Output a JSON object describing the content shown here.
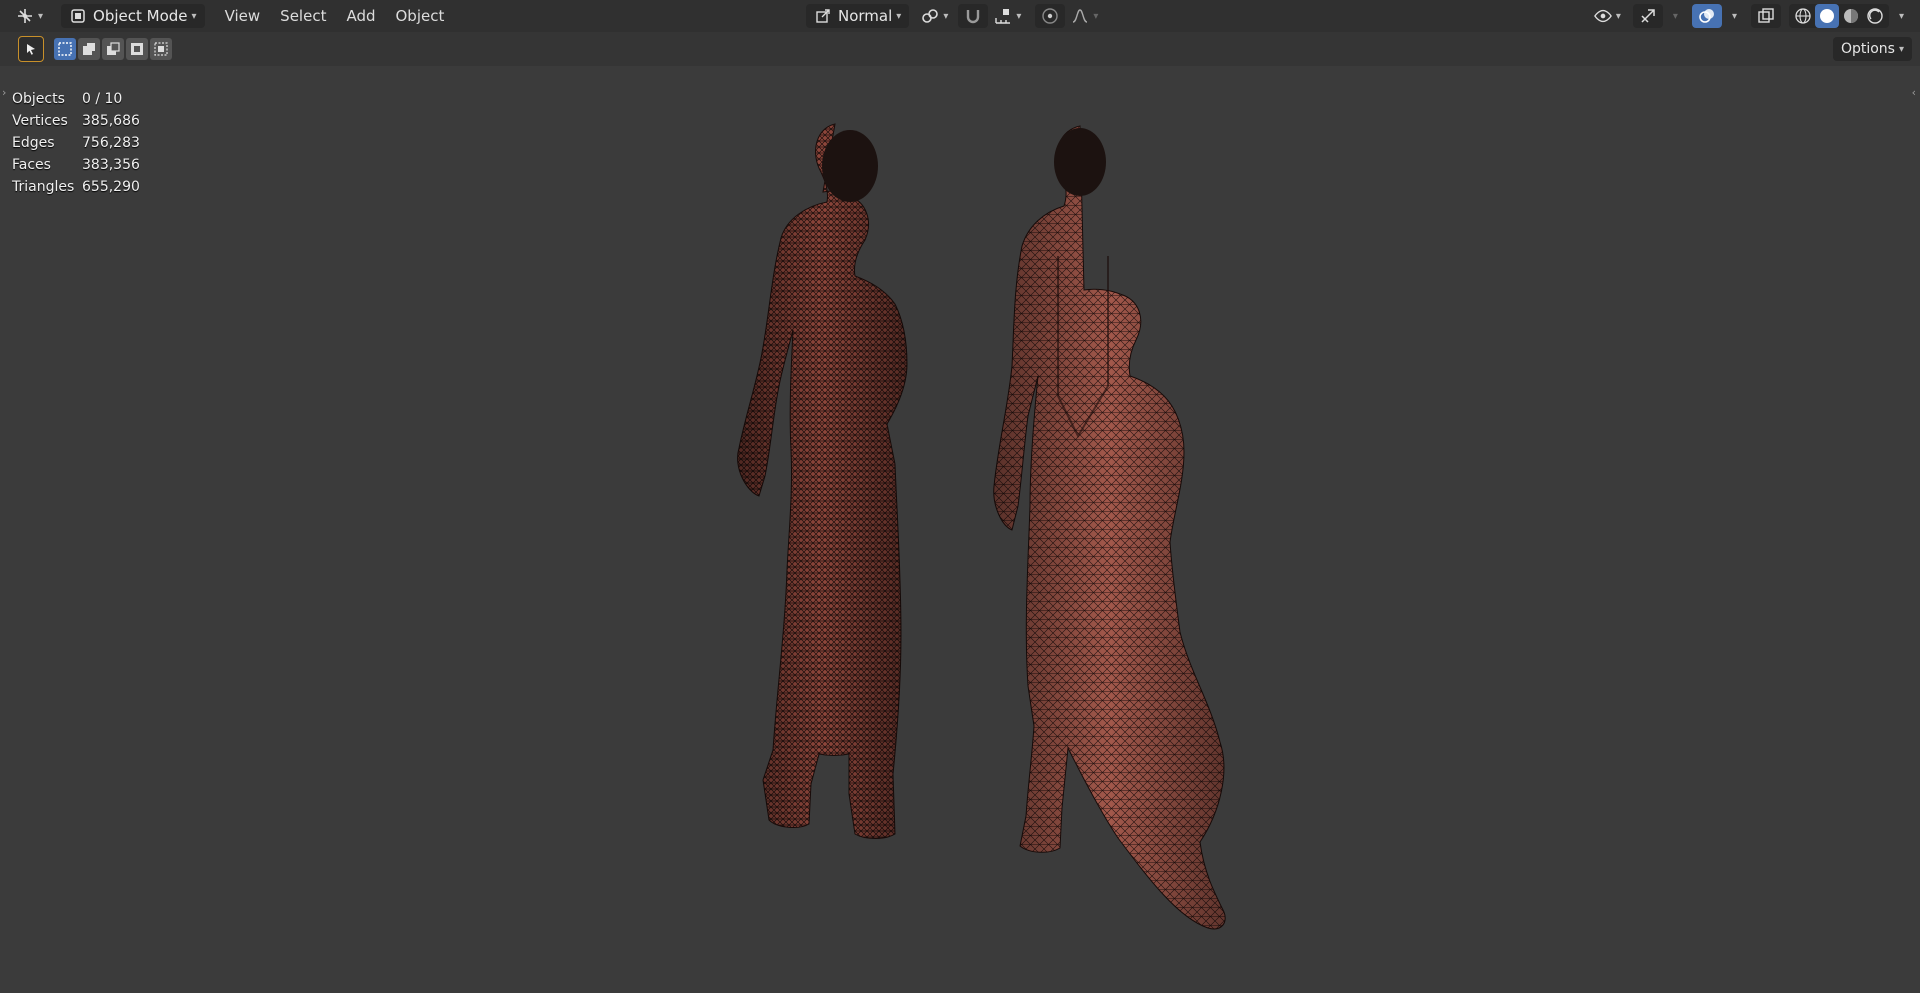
{
  "header": {
    "mode_label": "Object Mode",
    "menu": [
      "View",
      "Select",
      "Add",
      "Object"
    ],
    "orientation_label": "Normal"
  },
  "toolbar": {
    "options_label": "Options"
  },
  "stats": [
    {
      "label": "Objects",
      "value": "0 / 10"
    },
    {
      "label": "Vertices",
      "value": "385,686"
    },
    {
      "label": "Edges",
      "value": "756,283"
    },
    {
      "label": "Faces",
      "value": "383,356"
    },
    {
      "label": "Triangles",
      "value": "655,290"
    }
  ],
  "colors": {
    "accent": "#4772b3",
    "tool_highlight": "#c8902a",
    "mesh_fill": "#9a4e42",
    "mesh_wire": "#1e100e"
  }
}
